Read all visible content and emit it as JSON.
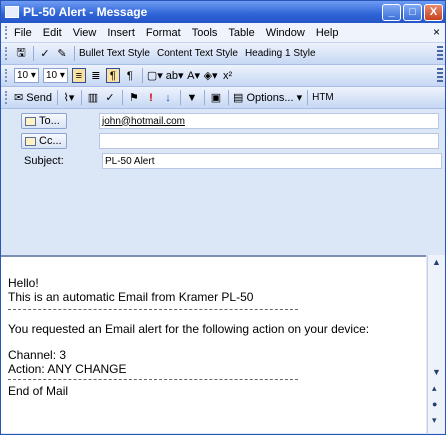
{
  "window": {
    "title": "PL-50 Alert - Message",
    "controls": {
      "minimize": "_",
      "maximize": "□",
      "close": "X"
    }
  },
  "menu": {
    "items": [
      "File",
      "Edit",
      "View",
      "Insert",
      "Format",
      "Tools",
      "Table",
      "Window",
      "Help"
    ],
    "close_glyph": "×"
  },
  "toolbar1": {
    "styles": [
      "Bullet Text Style",
      "Content Text Style",
      "Heading 1 Style"
    ]
  },
  "toolbar2": {
    "font_size_a": "10",
    "font_size_b": "10"
  },
  "toolbar3": {
    "send_label": "Send",
    "options_label": "Options...",
    "format_label": "HTM"
  },
  "fields": {
    "to_label": "To...",
    "to_value": "john@hotmail.com",
    "cc_label": "Cc...",
    "cc_value": "",
    "subject_label": "Subject:",
    "subject_value": "PL-50 Alert"
  },
  "message": {
    "greeting": "Hello!",
    "intro": "This is an automatic Email from Kramer PL-50",
    "request": "You requested an Email alert for the following action on your device:",
    "channel": "Channel: 3",
    "action": "Action: ANY CHANGE",
    "footer": "End of Mail"
  },
  "icons": {
    "app": "message-app-icon",
    "attach": "paperclip-icon",
    "addressbook": "address-book-icon",
    "flag": "flag-icon",
    "priority_high": "exclamation-icon",
    "priority_low": "down-arrow-icon"
  }
}
